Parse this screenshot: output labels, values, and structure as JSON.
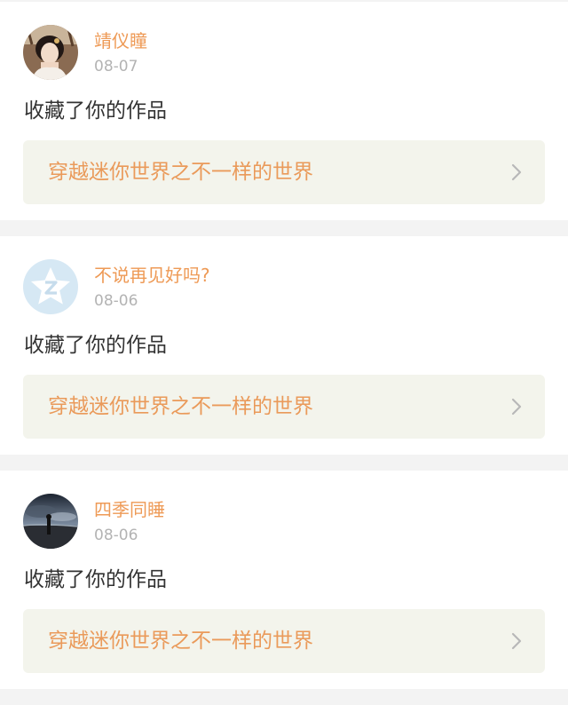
{
  "notifications": [
    {
      "avatar_icon": "portrait-avatar-icon",
      "user": "靖仪瞳",
      "date": "08-07",
      "action": "收藏了你的作品",
      "work_title": "穿越迷你世界之不一样的世界",
      "link_icon": "chevron-right-icon"
    },
    {
      "avatar_icon": "default-star-avatar-icon",
      "user": "不说再见好吗?",
      "date": "08-06",
      "action": "收藏了你的作品",
      "work_title": "穿越迷你世界之不一样的世界",
      "link_icon": "chevron-right-icon"
    },
    {
      "avatar_icon": "night-landscape-avatar-icon",
      "user": "四季同睡",
      "date": "08-06",
      "action": "收藏了你的作品",
      "work_title": "穿越迷你世界之不一样的世界",
      "link_icon": "chevron-right-icon"
    }
  ],
  "colors": {
    "page_background": "#f3f3f3",
    "card_background": "#ffffff",
    "username": "#ee9a56",
    "date": "#b3b3b3",
    "action_text": "#333333",
    "link_background": "#f3f4ec",
    "link_text": "#ea9a5a",
    "chevron": "#b8b8b8"
  }
}
